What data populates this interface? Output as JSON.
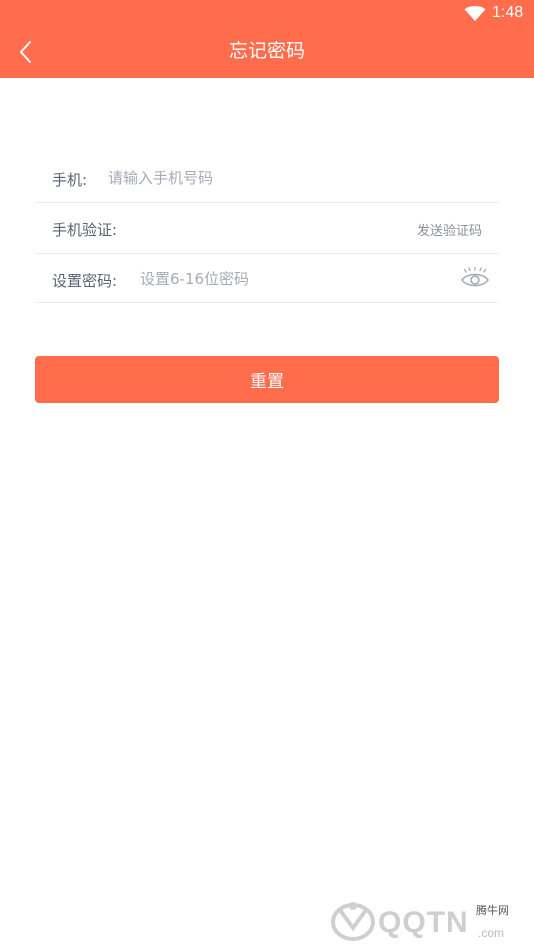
{
  "status_bar": {
    "time": "1:48",
    "wifi_icon": "wifi-icon"
  },
  "app_bar": {
    "title": "忘记密码",
    "back_icon": "chevron-left-icon"
  },
  "form": {
    "phone": {
      "label": "手机:",
      "placeholder": "请输入手机号码",
      "value": ""
    },
    "verify": {
      "label": "手机验证:",
      "send_code_label": "发送验证码",
      "value": ""
    },
    "password": {
      "label": "设置密码:",
      "placeholder": "设置6-16位密码",
      "value": "",
      "eye_icon": "eye-icon"
    }
  },
  "reset_button": {
    "label": "重置"
  },
  "watermark": {
    "brand": "QQTN",
    "cn": "腾牛网",
    "domain": ".com"
  },
  "colors": {
    "accent": "#ff6d4d",
    "label": "#5a6275",
    "placeholder": "#a6abb6",
    "divider": "#ececec"
  }
}
